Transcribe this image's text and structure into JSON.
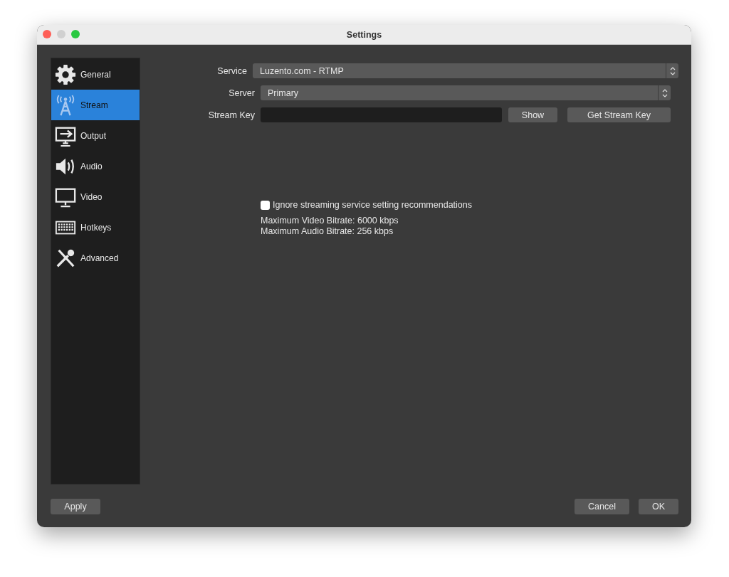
{
  "window": {
    "title": "Settings"
  },
  "sidebar": {
    "items": [
      {
        "label": "General",
        "kind": "gear",
        "selected": false
      },
      {
        "label": "Stream",
        "kind": "antenna",
        "selected": true
      },
      {
        "label": "Output",
        "kind": "output",
        "selected": false
      },
      {
        "label": "Audio",
        "kind": "speaker",
        "selected": false
      },
      {
        "label": "Video",
        "kind": "monitor",
        "selected": false
      },
      {
        "label": "Hotkeys",
        "kind": "keyboard",
        "selected": false
      },
      {
        "label": "Advanced",
        "kind": "tools",
        "selected": false
      }
    ]
  },
  "form": {
    "service": {
      "label": "Service",
      "value": "Luzento.com - RTMP"
    },
    "server": {
      "label": "Server",
      "value": "Primary"
    },
    "stream_key": {
      "label": "Stream Key",
      "buttons": [
        "Show",
        "Get Stream Key"
      ]
    }
  },
  "ignore_recommendations": {
    "label": "Ignore streaming service setting recommendations",
    "checked": false
  },
  "info": [
    "Maximum Video Bitrate: 6000 kbps",
    "Maximum Audio Bitrate: 256 kbps"
  ],
  "footer": {
    "apply": "Apply",
    "cancel": "Cancel",
    "ok": "OK"
  }
}
